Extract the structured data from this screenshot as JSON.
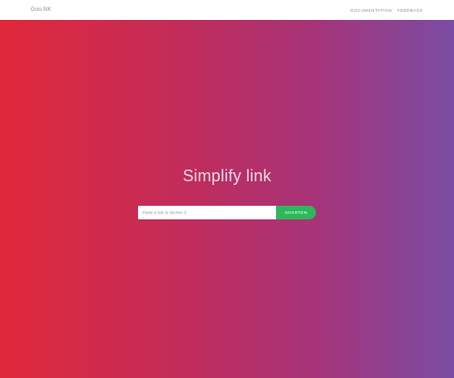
{
  "navbar": {
    "brand": "Goo.NK",
    "links": [
      "DOCUMENTATION",
      "FEEDBACK"
    ]
  },
  "hero": {
    "title": "Simplify link",
    "input_placeholder": "Paste a link to shorten it",
    "button_label": "SHORTEN",
    "button_color": "#2db85a",
    "gradient_colors": [
      "#e0283a",
      "#c22c5a",
      "#a6347a",
      "#7a4ca3"
    ]
  }
}
